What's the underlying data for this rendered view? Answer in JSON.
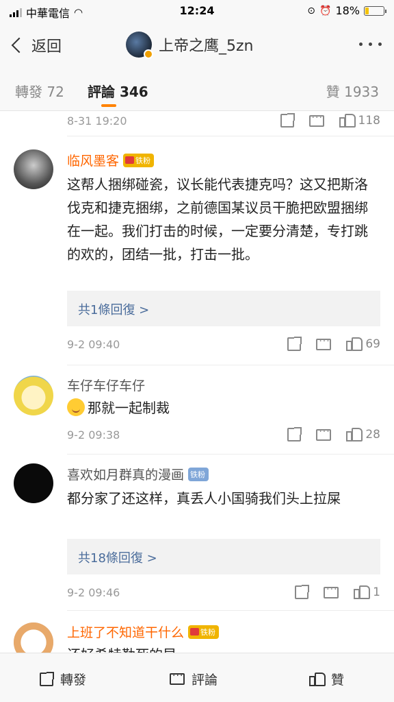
{
  "status_bar": {
    "carrier": "中華電信",
    "time": "12:24",
    "battery": "18%",
    "battery_level": 0.18
  },
  "nav": {
    "back_label": "返回",
    "title": "上帝之鹰_5zn"
  },
  "tabs": {
    "repost": "轉發 72",
    "comment": "評論 346",
    "like": "贊 1933"
  },
  "top_row": {
    "time": "8-31 19:20",
    "likes": "118"
  },
  "comments": [
    {
      "name": "临风墨客",
      "badge": "铁粉",
      "text": "这帮人捆绑碰瓷，议长能代表捷克吗？这又把斯洛伐克和捷克捆绑，之前德国某议员干脆把欧盟捆绑在一起。我们打击的时候，一定要分清楚，专打跳的欢的，团结一批，打击一批。",
      "replies": "共1條回復 >",
      "time": "9-2 09:40",
      "likes": "69"
    },
    {
      "name": "车仔车仔车仔",
      "text": "那就一起制裁",
      "time": "9-2 09:38",
      "likes": "28"
    },
    {
      "name": "喜欢如月群真的漫画",
      "badge": "铁粉",
      "text": "都分家了还这样，真丢人小国骑我们头上拉屎",
      "replies": "共18條回復 >",
      "time": "9-2 09:46",
      "likes": "1"
    },
    {
      "name": "上班了不知道干什么",
      "badge": "铁粉",
      "text": "还好希特勒死的早"
    }
  ],
  "bottom_bar": {
    "repost": "轉發",
    "comment": "評論",
    "like": "贊"
  }
}
